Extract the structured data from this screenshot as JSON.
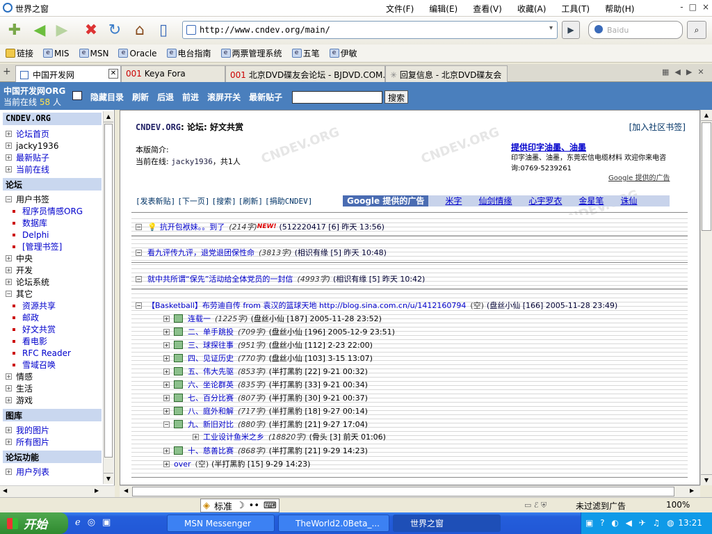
{
  "window": {
    "title": "世界之窗",
    "controls": [
      "-",
      "□",
      "×"
    ]
  },
  "menu": [
    "文件(F)",
    "编辑(E)",
    "查看(V)",
    "收藏(A)",
    "工具(T)",
    "帮助(H)"
  ],
  "address": {
    "url": "http://www.cndev.org/main/",
    "search_placeholder": "Baidu"
  },
  "favorites": [
    "链接",
    "MIS",
    "MSN",
    "Oracle",
    "电台指南",
    "两票管理系统",
    "五笔",
    "伊敏"
  ],
  "tabs": [
    {
      "label": "中国开发网",
      "num": ""
    },
    {
      "label": "Keya Fora",
      "num": "001"
    },
    {
      "label": "北京DVD碟友会论坛 - BJDVD.COM...",
      "num": "001"
    },
    {
      "label": "回复信息 - 北京DVD碟友会",
      "num": ""
    }
  ],
  "site": {
    "logo": "中国开发网ORG",
    "online_prefix": "当前在线",
    "online_count": "58",
    "online_suffix": "人",
    "links": [
      "隐藏目录",
      "刷新",
      "后退",
      "前进",
      "滚屏开关",
      "最新贴子"
    ],
    "search_button": "搜索"
  },
  "sidebar": {
    "header1": "CNDEV.ORG",
    "items1": [
      "论坛首页",
      "jacky1936",
      "最新贴子",
      "当前在线"
    ],
    "header2": "论坛",
    "bookmarks_label": "用户书签",
    "bookmarks": [
      "程序员情感ORG",
      "数据库",
      "Delphi",
      "[管理书签]"
    ],
    "groups": [
      "中央",
      "开发",
      "论坛系统"
    ],
    "other_label": "其它",
    "other": [
      "资源共享",
      "邮政",
      "好文共赏",
      "看电影",
      "RFC Reader",
      "雪域召唤"
    ],
    "groups2": [
      "情感",
      "生活",
      "游戏"
    ],
    "header3": "图库",
    "gallery": [
      "我的图片",
      "所有图片"
    ],
    "header4": "论坛功能",
    "functions": [
      "用户列表"
    ]
  },
  "main": {
    "brand": "CNDEV.ORG",
    "crumb": ": 论坛: 好文共赏",
    "join": "[加入社区书签]",
    "intro_label": "本版简介:",
    "online_label": "当前在线:",
    "online_user": "jacky1936",
    "online_tail": "，共1人",
    "ad_title": "提供印字油墨、油墨",
    "ad_body": "印字油墨、油墨，东莞宏信电缆材料 欢迎你来电咨询:0769-5239261",
    "ad_google": "Google 提供的广告",
    "actions": [
      "[发表新贴]",
      "[下一页]",
      "[搜索]",
      "[刷新]",
      "[捐助CNDEV]"
    ],
    "gbar_label": "Google 提供的广告",
    "gbar_links": [
      "米字",
      "仙剑情缘",
      "心宇罗衣",
      "金星笔",
      "诛仙"
    ],
    "threads": [
      {
        "title": "抗开包袱妹。。到了",
        "size": "(214字)",
        "new": "NEW!",
        "meta": "(512220417 [6] 昨天 13:56)"
      },
      {
        "title": "看九评传九评，退党退团保性命",
        "size": "(3813字)",
        "meta": "(相识有缘 [5] 昨天 10:48)"
      },
      {
        "title": "就中共所谓“保先”活动给全体党员的一封信",
        "size": "(4993字)",
        "meta": "(相识有缘 [5] 昨天 10:42)"
      },
      {
        "title": "【Basketball】布劳迪自传 from 袁汉的篮球天地 http://blog.sina.com.cn/u/1412160794",
        "size": "(空)",
        "meta": "(盘丝小仙 [166] 2005-11-28 23:49)"
      }
    ],
    "subs": [
      {
        "title": "连载一",
        "size": "(1225字)",
        "meta": "(盘丝小仙 [187] 2005-11-28 23:52)"
      },
      {
        "title": "二、单手跳投",
        "size": "(709字)",
        "meta": "(盘丝小仙 [196] 2005-12-9 23:51)"
      },
      {
        "title": "三、球探往事",
        "size": "(951字)",
        "meta": "(盘丝小仙 [112] 2-23 22:00)"
      },
      {
        "title": "四、见证历史",
        "size": "(770字)",
        "meta": "(盘丝小仙 [103] 3-15 13:07)"
      },
      {
        "title": "五、伟大先驱",
        "size": "(853字)",
        "meta": "(半打黑豹 [22] 9-21 00:32)"
      },
      {
        "title": "六、坐论群英",
        "size": "(835字)",
        "meta": "(半打黑豹 [33] 9-21 00:34)"
      },
      {
        "title": "七、百分比赛",
        "size": "(807字)",
        "meta": "(半打黑豹 [30] 9-21 00:37)"
      },
      {
        "title": "八、庭外和解",
        "size": "(717字)",
        "meta": "(半打黑豹 [18] 9-27 00:14)"
      },
      {
        "title": "九、新旧对比",
        "size": "(880字)",
        "meta": "(半打黑豹 [21] 9-27 17:04)"
      },
      {
        "title": "工业设计鱼米之乡",
        "size": "(18820字)",
        "meta": "(骨头 [3] 前天 01:06)"
      },
      {
        "title": "十、慈善比赛",
        "size": "(868字)",
        "meta": "(半打黑豹 [21] 9-29 14:23)"
      },
      {
        "title": "over",
        "size": "(空)",
        "meta": "(半打黑豹 [15] 9-29 14:23)"
      }
    ],
    "watermark": "CNDEV.ORG"
  },
  "statusbar": {
    "ime": [
      "标准",
      "☽",
      "••",
      "⌨"
    ],
    "adfilter": "未过滤到广告",
    "zoom": "100%"
  },
  "taskbar": {
    "start": "开始",
    "tasks": [
      "MSN Messenger",
      "TheWorld2.0Beta_...",
      "世界之窗"
    ],
    "clock": "13:21"
  }
}
